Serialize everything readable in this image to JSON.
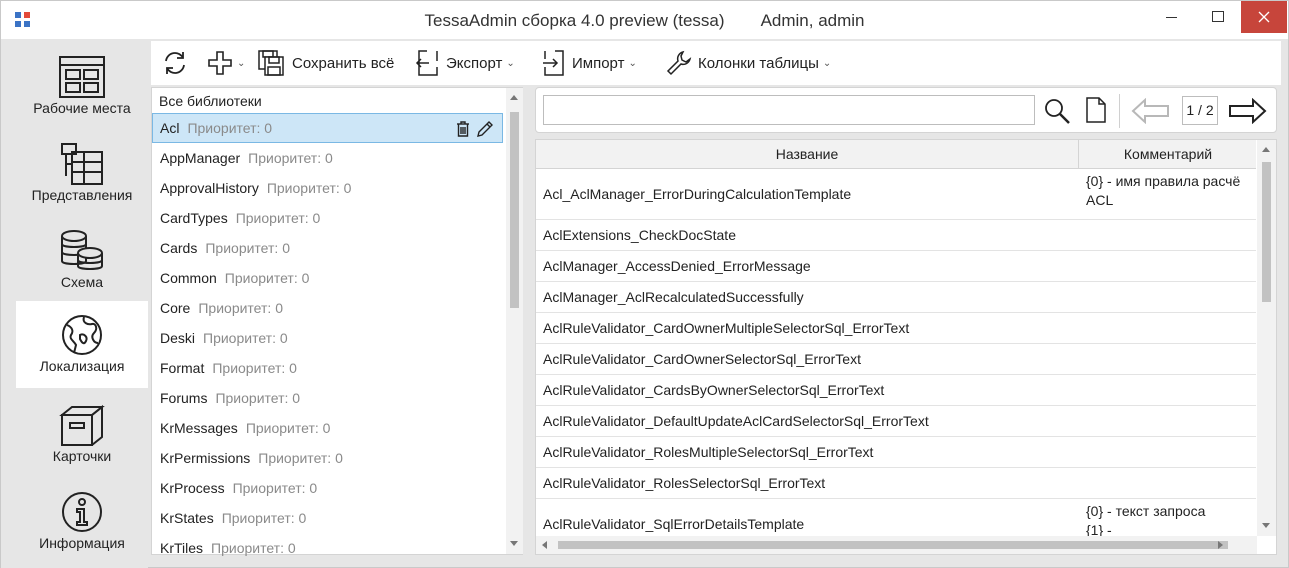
{
  "window": {
    "title": "TessaAdmin сборка 4.0 preview (tessa)",
    "user": "Admin, admin",
    "accent_color": "#c7453b",
    "logo_colors": [
      "#3b73c5",
      "#e34a3a",
      "#3b73c5",
      "#3b73c5"
    ]
  },
  "nav": {
    "items": [
      {
        "label": "Рабочие места",
        "icon": "workplaces-icon"
      },
      {
        "label": "Представления",
        "icon": "views-icon"
      },
      {
        "label": "Схема",
        "icon": "database-icon"
      },
      {
        "label": "Локализация",
        "icon": "globe-icon",
        "active": true
      },
      {
        "label": "Карточки",
        "icon": "box-icon"
      },
      {
        "label": "Информация",
        "icon": "info-icon"
      }
    ]
  },
  "toolbar": {
    "save_all": "Сохранить всё",
    "export": "Экспорт",
    "import": "Импорт",
    "columns": "Колонки таблицы"
  },
  "libraries": {
    "header": "Все библиотеки",
    "priority_label": "Приоритет: 0",
    "items": [
      {
        "name": "Acl",
        "selected": true
      },
      {
        "name": "AppManager"
      },
      {
        "name": "ApprovalHistory"
      },
      {
        "name": "CardTypes"
      },
      {
        "name": "Cards"
      },
      {
        "name": "Common"
      },
      {
        "name": "Core"
      },
      {
        "name": "Deski"
      },
      {
        "name": "Format"
      },
      {
        "name": "Forums"
      },
      {
        "name": "KrMessages"
      },
      {
        "name": "KrPermissions"
      },
      {
        "name": "KrProcess"
      },
      {
        "name": "KrStates"
      },
      {
        "name": "KrTiles"
      }
    ]
  },
  "search": {
    "value": "",
    "placeholder": "",
    "page": "1 / 2"
  },
  "table": {
    "columns": [
      "Название",
      "Комментарий"
    ],
    "rows": [
      {
        "name": "Acl_AclManager_ErrorDuringCalculationTemplate",
        "comment": "{0} - имя правила расчё\nACL"
      },
      {
        "name": "AclExtensions_CheckDocState",
        "comment": ""
      },
      {
        "name": "AclManager_AccessDenied_ErrorMessage",
        "comment": ""
      },
      {
        "name": "AclManager_AclRecalculatedSuccessfully",
        "comment": ""
      },
      {
        "name": "AclRuleValidator_CardOwnerMultipleSelectorSql_ErrorText",
        "comment": ""
      },
      {
        "name": "AclRuleValidator_CardOwnerSelectorSql_ErrorText",
        "comment": ""
      },
      {
        "name": "AclRuleValidator_CardsByOwnerSelectorSql_ErrorText",
        "comment": ""
      },
      {
        "name": "AclRuleValidator_DefaultUpdateAclCardSelectorSql_ErrorText",
        "comment": ""
      },
      {
        "name": "AclRuleValidator_RolesMultipleSelectorSql_ErrorText",
        "comment": ""
      },
      {
        "name": "AclRuleValidator_RolesSelectorSql_ErrorText",
        "comment": ""
      },
      {
        "name": "AclRuleValidator_SqlErrorDetailsTemplate",
        "comment": "{0} - текст запроса\n{1} -"
      }
    ]
  }
}
